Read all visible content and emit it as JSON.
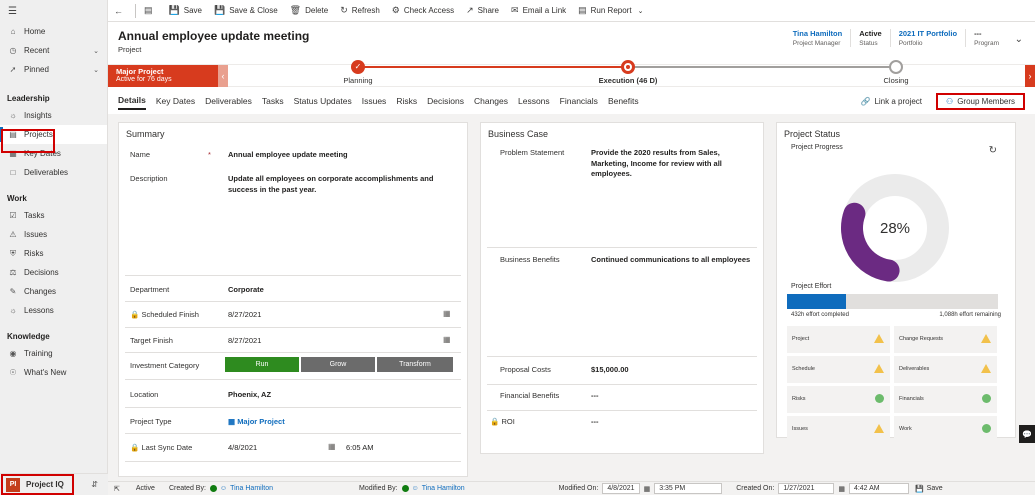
{
  "sidebar": {
    "top_items": [
      {
        "label": "Home",
        "icon": "home-icon"
      },
      {
        "label": "Recent",
        "icon": "clock-icon",
        "expandable": true
      },
      {
        "label": "Pinned",
        "icon": "pin-icon",
        "expandable": true
      }
    ],
    "groups": [
      {
        "title": "Leadership",
        "items": [
          {
            "label": "Insights",
            "icon": "lightbulb-icon"
          },
          {
            "label": "Projects",
            "icon": "projects-icon",
            "active": true
          },
          {
            "label": "Key Dates",
            "icon": "calendar-icon"
          },
          {
            "label": "Deliverables",
            "icon": "box-icon"
          }
        ]
      },
      {
        "title": "Work",
        "items": [
          {
            "label": "Tasks",
            "icon": "checkbox-icon"
          },
          {
            "label": "Issues",
            "icon": "warning-icon"
          },
          {
            "label": "Risks",
            "icon": "shield-icon"
          },
          {
            "label": "Decisions",
            "icon": "gavel-icon"
          },
          {
            "label": "Changes",
            "icon": "pencil-icon"
          },
          {
            "label": "Lessons",
            "icon": "lightbulb-icon"
          }
        ]
      },
      {
        "title": "Knowledge",
        "items": [
          {
            "label": "Training",
            "icon": "training-icon"
          },
          {
            "label": "What's New",
            "icon": "globe-icon"
          }
        ]
      }
    ],
    "footer": {
      "badge": "PI",
      "app_name": "Project IQ"
    }
  },
  "commands": [
    {
      "label": "Save",
      "icon": "save-icon"
    },
    {
      "label": "Save & Close",
      "icon": "save-close-icon"
    },
    {
      "label": "Delete",
      "icon": "trash-icon"
    },
    {
      "label": "Refresh",
      "icon": "refresh-icon"
    },
    {
      "label": "Check Access",
      "icon": "check-access-icon"
    },
    {
      "label": "Share",
      "icon": "share-icon"
    },
    {
      "label": "Email a Link",
      "icon": "email-icon"
    },
    {
      "label": "Run Report",
      "icon": "report-icon"
    }
  ],
  "header": {
    "title": "Annual employee update meeting",
    "type": "Project",
    "fields": [
      {
        "value": "Tina Hamilton",
        "label": "Project Manager",
        "link": true
      },
      {
        "value": "Active",
        "label": "Status",
        "link": false
      },
      {
        "value": "2021 IT Portfolio",
        "label": "Portfolio",
        "link": true
      },
      {
        "value": "---",
        "label": "Program",
        "link": false
      }
    ]
  },
  "bpf": {
    "active_stage_name": "Major Project",
    "active_stage_duration": "Active for 76 days",
    "stages": [
      {
        "label": "Planning",
        "state": "done"
      },
      {
        "label": "Execution",
        "duration": "(46 D)",
        "state": "current"
      },
      {
        "label": "Closing",
        "state": "pending"
      }
    ]
  },
  "tabs": [
    "Details",
    "Key Dates",
    "Deliverables",
    "Tasks",
    "Status Updates",
    "Issues",
    "Risks",
    "Decisions",
    "Changes",
    "Lessons",
    "Financials",
    "Benefits"
  ],
  "tab_actions": {
    "link_project": "Link a project",
    "group_members": "Group Members"
  },
  "summary": {
    "title": "Summary",
    "name_label": "Name",
    "name_required": "*",
    "name_value": "Annual employee update meeting",
    "description_label": "Description",
    "description_value": "Update all employees on corporate accomplishments and success in the past year.",
    "department_label": "Department",
    "department_value": "Corporate",
    "sched_finish_label": "Scheduled Finish",
    "sched_finish_value": "8/27/2021",
    "target_finish_label": "Target Finish",
    "target_finish_value": "8/27/2021",
    "investment_label": "Investment Category",
    "investment_options": [
      "Run",
      "Grow",
      "Transform"
    ],
    "investment_selected": "Run",
    "location_label": "Location",
    "location_value": "Phoenix, AZ",
    "project_type_label": "Project Type",
    "project_type_value": "Major Project",
    "last_sync_label": "Last Sync Date",
    "last_sync_date": "4/8/2021",
    "last_sync_time": "6:05 AM"
  },
  "business_case": {
    "title": "Business Case",
    "problem_label": "Problem Statement",
    "problem_value": "Provide the 2020 results from Sales, Marketing, Income for review with all employees.",
    "benefits_label": "Business Benefits",
    "benefits_value": "Continued communications to all employees",
    "proposal_label": "Proposal Costs",
    "proposal_value": "$15,000.00",
    "fin_benefits_label": "Financial Benefits",
    "fin_benefits_value": "---",
    "roi_label": "ROI",
    "roi_value": "---"
  },
  "project_status": {
    "title": "Project Status",
    "progress_label": "Project Progress",
    "progress_percent": 28,
    "progress_text": "28%",
    "effort_label": "Project Effort",
    "effort_fraction": 0.28,
    "effort_completed": "432h effort completed",
    "effort_remaining": "1,088h effort remaining",
    "tiles": [
      {
        "label": "Project",
        "status": "warning"
      },
      {
        "label": "Change Requests",
        "status": "warning"
      },
      {
        "label": "Schedule",
        "status": "warning"
      },
      {
        "label": "Deliverables",
        "status": "warning"
      },
      {
        "label": "Risks",
        "status": "good"
      },
      {
        "label": "Financials",
        "status": "good"
      },
      {
        "label": "Issues",
        "status": "warning"
      },
      {
        "label": "Work",
        "status": "good"
      }
    ],
    "colors": {
      "donut": "#6b2a82",
      "track": "#ebebeb",
      "warning": "#f2c14b",
      "good": "#6cbb6c"
    }
  },
  "footer": {
    "status": "Active",
    "created_by_label": "Created By:",
    "created_by": "Tina Hamilton",
    "modified_by_label": "Modified By:",
    "modified_by": "Tina Hamilton",
    "modified_on_label": "Modified On:",
    "modified_on_date": "4/8/2021",
    "modified_on_time": "3:35 PM",
    "created_on_label": "Created On:",
    "created_on_date": "1/27/2021",
    "created_on_time": "4:42 AM",
    "save_label": "Save"
  }
}
